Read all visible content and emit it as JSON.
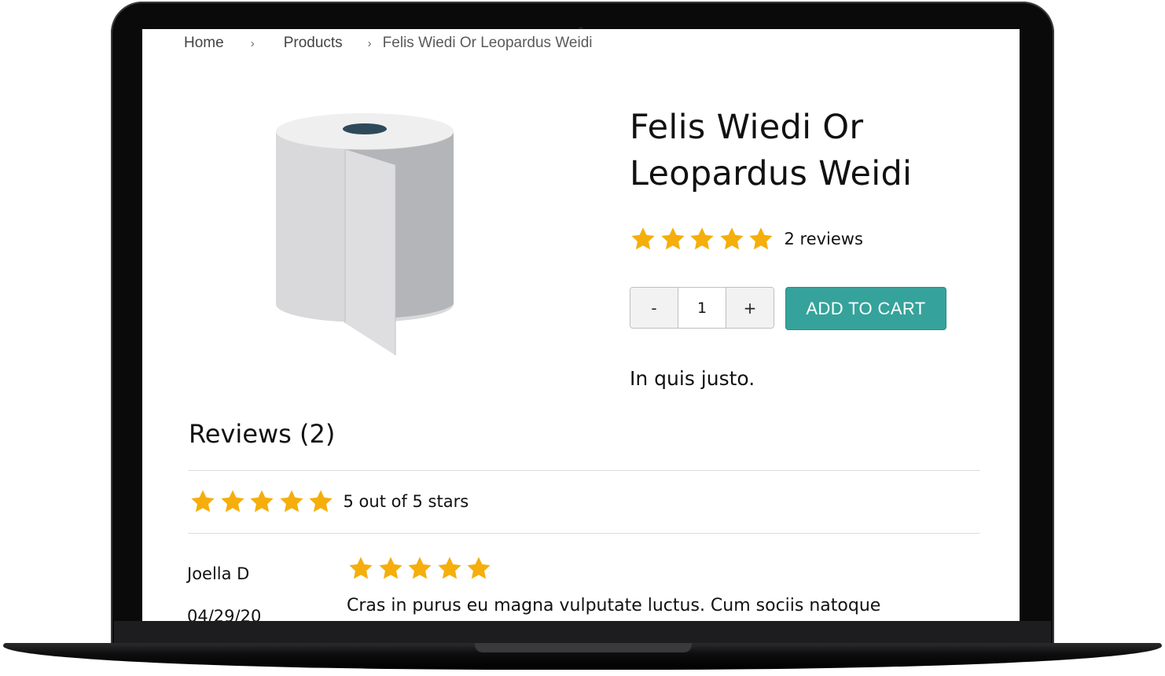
{
  "breadcrumb": {
    "home": "Home",
    "separator": "›",
    "products": "Products",
    "current": "Felis Wiedi Or Leopardus Weidi"
  },
  "product": {
    "title": "Felis Wiedi Or Leopardus Weidi",
    "rating": 5,
    "reviews_link": "2 reviews",
    "quantity": "1",
    "minus_label": "-",
    "plus_label": "+",
    "add_to_cart_label": "ADD TO CART",
    "description": "In quis justo.",
    "image_icon": "toilet-paper-roll-image"
  },
  "reviews": {
    "heading": "Reviews (2)",
    "summary_rating": 5,
    "summary_text": "5 out of 5 stars",
    "items": [
      {
        "author": "Joella D",
        "date": "04/29/20",
        "rating": 5,
        "body": "Cras in purus eu magna vulputate luctus. Cum sociis natoque"
      }
    ]
  },
  "colors": {
    "star": "#f5ae0b",
    "accent_button": "#35a39b",
    "text": "#111111"
  }
}
